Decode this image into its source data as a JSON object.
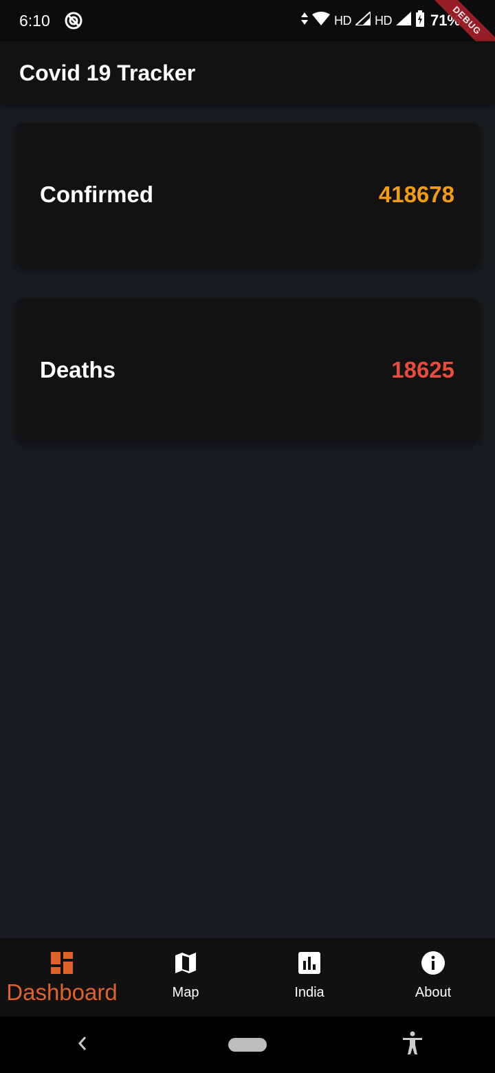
{
  "status_bar": {
    "time": "6:10",
    "network_1": "HD",
    "network_2": "HD",
    "battery": "71%",
    "debug_label": "DEBUG"
  },
  "app_bar": {
    "title": "Covid 19 Tracker"
  },
  "cards": [
    {
      "label": "Confirmed",
      "value": "418678",
      "color": "#f39c12"
    },
    {
      "label": "Deaths",
      "value": "18625",
      "color": "#e74c3c"
    }
  ],
  "bottom_nav": {
    "active_color": "#e0622a",
    "items": [
      {
        "label": "Dashboard",
        "icon": "dashboard-icon",
        "active": true
      },
      {
        "label": "Map",
        "icon": "map-icon",
        "active": false
      },
      {
        "label": "India",
        "icon": "bar-chart-icon",
        "active": false
      },
      {
        "label": "About",
        "icon": "info-icon",
        "active": false
      }
    ]
  },
  "system_nav": {
    "back": "back-icon",
    "home": "home-pill",
    "accessibility": "accessibility-icon"
  }
}
